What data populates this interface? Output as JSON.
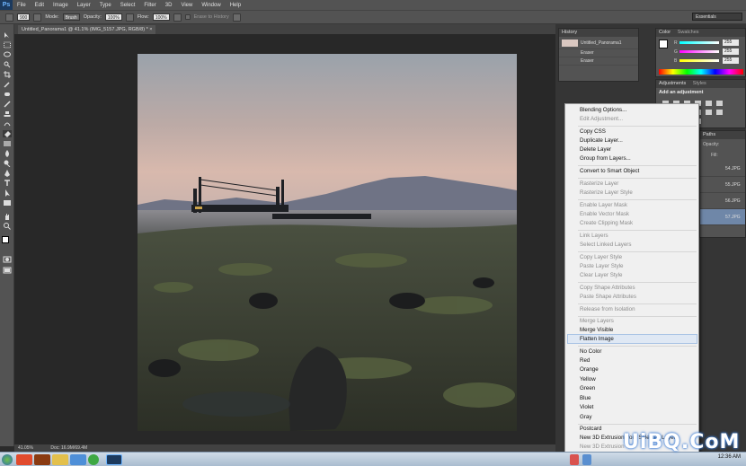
{
  "app": {
    "logo": "Ps"
  },
  "menubar": [
    "File",
    "Edit",
    "Image",
    "Layer",
    "Type",
    "Select",
    "Filter",
    "3D",
    "View",
    "Window",
    "Help"
  ],
  "options": {
    "brush_size": "900",
    "mode_label": "Mode:",
    "mode_value": "Brush",
    "opacity_label": "Opacity:",
    "opacity_value": "100%",
    "flow_label": "Flow:",
    "flow_value": "100%",
    "erase_history": "Erase to History",
    "workspace": "Essentials"
  },
  "document": {
    "tab_title": "Untitled_Panorama1 @ 41.1% (IMG_5157.JPG, RGB/8) *",
    "zoom": "41.05%",
    "doc_info": "Doc: 16.9M/69.4M"
  },
  "history": {
    "tab": "History",
    "rows": [
      "Untitled_Panorama1",
      "Eraser",
      "Eraser"
    ]
  },
  "color_panel": {
    "tabs": [
      "Color",
      "Swatches"
    ],
    "channels": [
      {
        "label": "R",
        "value": "255"
      },
      {
        "label": "G",
        "value": "255"
      },
      {
        "label": "B",
        "value": "255"
      }
    ]
  },
  "adjustments": {
    "tabs": [
      "Adjustments",
      "Styles"
    ],
    "heading": "Add an adjustment"
  },
  "layers_panel": {
    "tab": "Paths",
    "opacity_label": "Opacity:",
    "fill_label": "Fill:",
    "rows": [
      "54.JPG",
      "55.JPG",
      "56.JPG",
      "57.JPG"
    ]
  },
  "context_menu": {
    "items": [
      {
        "label": "Blending Options...",
        "disabled": false
      },
      {
        "label": "Edit Adjustment...",
        "disabled": true
      },
      {
        "label": "Copy CSS",
        "disabled": false
      },
      {
        "label": "Duplicate Layer...",
        "disabled": false
      },
      {
        "label": "Delete Layer",
        "disabled": false
      },
      {
        "label": "Group from Layers...",
        "disabled": false
      },
      {
        "label": "Convert to Smart Object",
        "disabled": false
      },
      {
        "label": "Rasterize Layer",
        "disabled": true
      },
      {
        "label": "Rasterize Layer Style",
        "disabled": true
      },
      {
        "label": "Enable Layer Mask",
        "disabled": true
      },
      {
        "label": "Enable Vector Mask",
        "disabled": true
      },
      {
        "label": "Create Clipping Mask",
        "disabled": true
      },
      {
        "label": "Link Layers",
        "disabled": true
      },
      {
        "label": "Select Linked Layers",
        "disabled": true
      },
      {
        "label": "Copy Layer Style",
        "disabled": true
      },
      {
        "label": "Paste Layer Style",
        "disabled": true
      },
      {
        "label": "Clear Layer Style",
        "disabled": true
      },
      {
        "label": "Copy Shape Attributes",
        "disabled": true
      },
      {
        "label": "Paste Shape Attributes",
        "disabled": true
      },
      {
        "label": "Release from Isolation",
        "disabled": true
      },
      {
        "label": "Merge Layers",
        "disabled": true
      },
      {
        "label": "Merge Visible",
        "disabled": false
      },
      {
        "label": "Flatten Image",
        "disabled": false,
        "highlighted": true
      },
      {
        "label": "No Color",
        "disabled": false
      },
      {
        "label": "Red",
        "disabled": false
      },
      {
        "label": "Orange",
        "disabled": false
      },
      {
        "label": "Yellow",
        "disabled": false
      },
      {
        "label": "Green",
        "disabled": false
      },
      {
        "label": "Blue",
        "disabled": false
      },
      {
        "label": "Violet",
        "disabled": false
      },
      {
        "label": "Gray",
        "disabled": false
      },
      {
        "label": "Postcard",
        "disabled": false
      },
      {
        "label": "New 3D Extrusion from Selected Layer",
        "disabled": false
      },
      {
        "label": "New 3D Extrusion",
        "disabled": true
      }
    ]
  },
  "taskbar": {
    "clock": "12:36 AM"
  },
  "watermark": "UiBQ.CoM"
}
